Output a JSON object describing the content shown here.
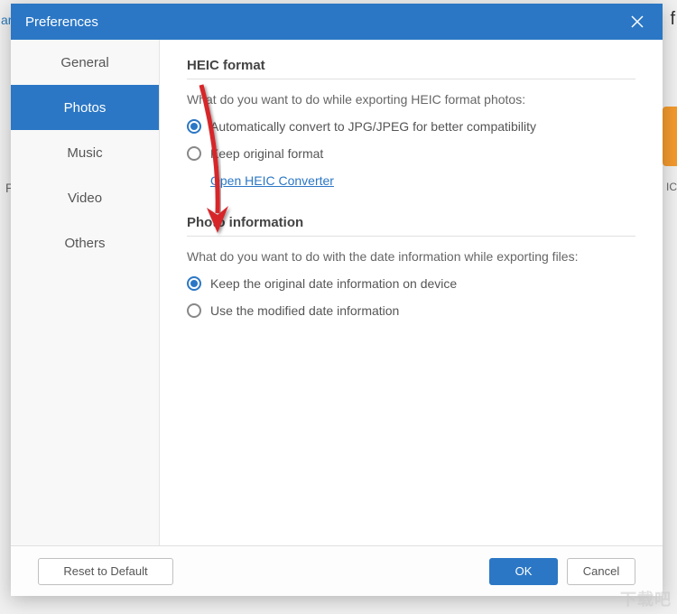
{
  "bg": {
    "left": "ar",
    "p": "P",
    "f": "f",
    "ic": "IC"
  },
  "title": "Preferences",
  "sidebar": {
    "items": [
      {
        "label": "General"
      },
      {
        "label": "Photos"
      },
      {
        "label": "Music"
      },
      {
        "label": "Video"
      },
      {
        "label": "Others"
      }
    ],
    "activeIndex": 1
  },
  "sections": {
    "heic": {
      "title": "HEIC format",
      "desc": "What do you want to do while exporting HEIC format photos:",
      "opt1": "Automatically convert to JPG/JPEG for better compatibility",
      "opt2": "Keep original format",
      "link": "Open HEIC Converter"
    },
    "photoinfo": {
      "title": "Photo information",
      "desc": "What do you want to do with the date information while exporting files:",
      "opt1": "Keep the original date information on device",
      "opt2": "Use the modified date information"
    }
  },
  "footer": {
    "reset": "Reset to Default",
    "ok": "OK",
    "cancel": "Cancel"
  },
  "watermark": "下载吧"
}
